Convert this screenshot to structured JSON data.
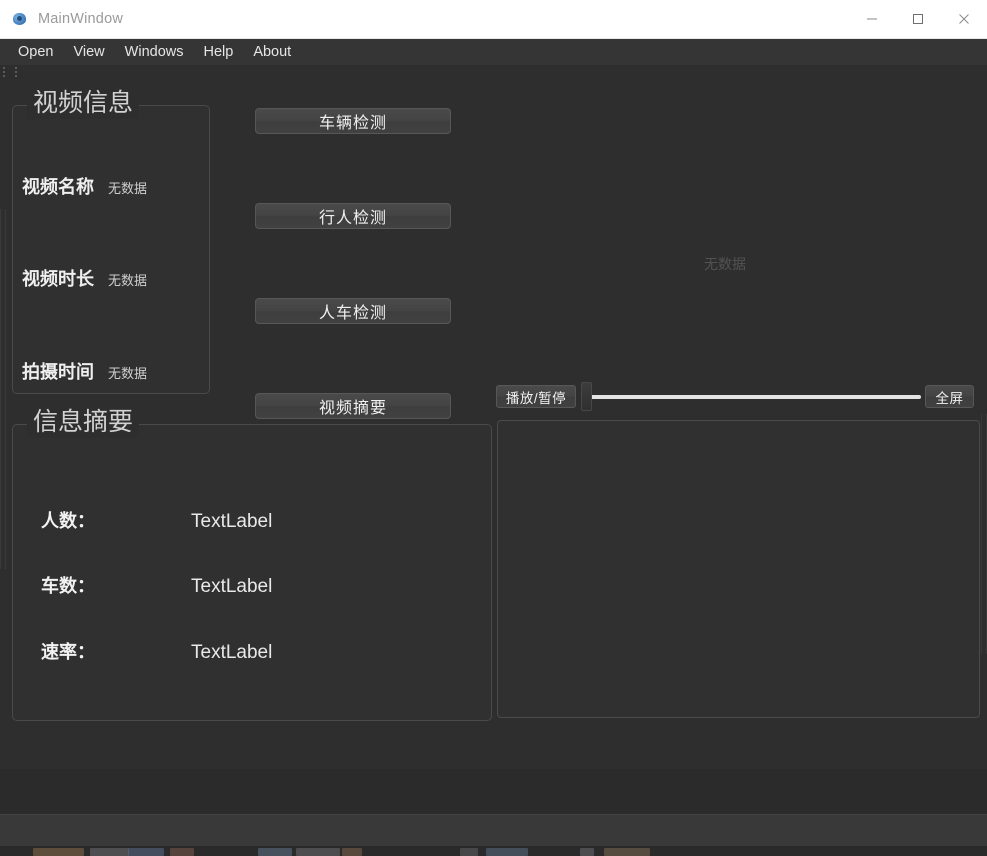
{
  "window": {
    "title": "MainWindow",
    "icon": "qt-logo-icon",
    "controls": {
      "minimize": "minimize-icon",
      "maximize": "maximize-icon",
      "close": "close-icon"
    }
  },
  "menubar": {
    "items": [
      {
        "label": "Open"
      },
      {
        "label": "View"
      },
      {
        "label": "Windows"
      },
      {
        "label": "Help"
      },
      {
        "label": "About"
      }
    ]
  },
  "toolbar": {
    "grip": "toolbar-grip-handle"
  },
  "video_info": {
    "title": "视频信息",
    "rows": [
      {
        "label": "视频名称",
        "value": "无数据"
      },
      {
        "label": "视频时长",
        "value": "无数据"
      },
      {
        "label": "拍摄时间",
        "value": "无数据"
      }
    ]
  },
  "actions": {
    "buttons": [
      {
        "label": "车辆检测"
      },
      {
        "label": "行人检测"
      },
      {
        "label": "人车检测"
      },
      {
        "label": "视频摘要"
      }
    ]
  },
  "player": {
    "placeholder": "无数据",
    "play_pause_label": "播放/暂停",
    "fullscreen_label": "全屏",
    "progress_percent": 0
  },
  "summary": {
    "title": "信息摘要",
    "rows": [
      {
        "label": "人数：",
        "value": "TextLabel"
      },
      {
        "label": "车数：",
        "value": "TextLabel"
      },
      {
        "label": "速率：",
        "value": "TextLabel"
      }
    ]
  },
  "colors": {
    "window_bg": "#2e2e2e",
    "panel_bg": "#303030",
    "titlebar_bg": "#ffffff",
    "menubar_bg": "#353535",
    "border": "#4a4a4a",
    "text_primary": "#efefef",
    "text_muted": "#cfcfcf",
    "slider_groove": "#e4e4e4"
  }
}
